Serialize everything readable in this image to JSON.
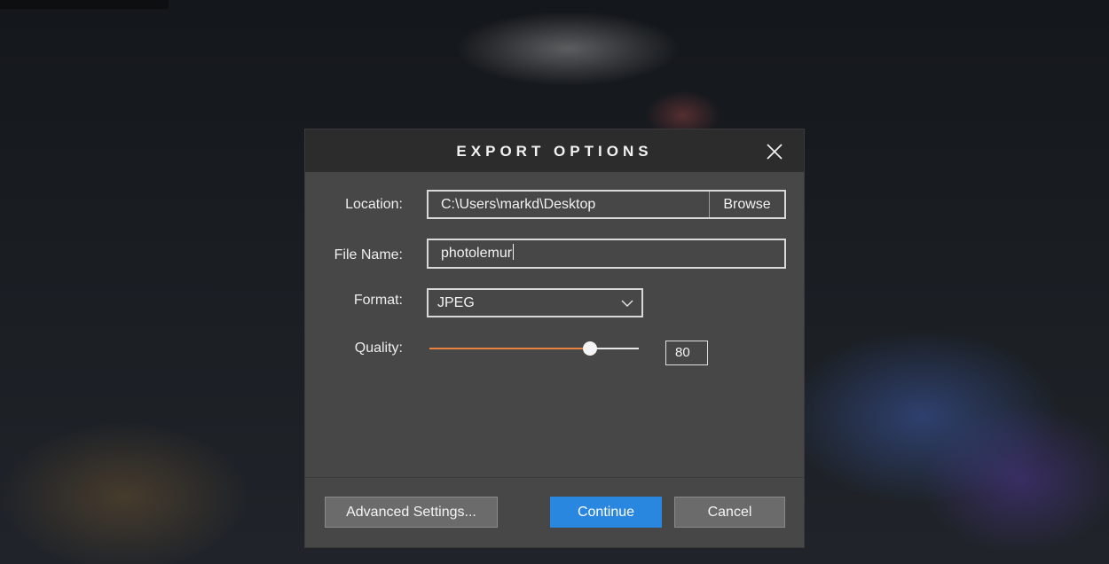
{
  "dialog": {
    "title": "EXPORT OPTIONS",
    "close_icon": "close-icon"
  },
  "location": {
    "label": "Location:",
    "value": "C:\\Users\\markd\\Desktop",
    "browse_label": "Browse"
  },
  "file_name": {
    "label": "File Name:",
    "value": "photolemur"
  },
  "format": {
    "label": "Format:",
    "selected": "JPEG",
    "dropdown_icon": "chevron-down-icon"
  },
  "quality": {
    "label": "Quality:",
    "value": "80",
    "percent": 80
  },
  "footer": {
    "advanced_label": "Advanced Settings...",
    "continue_label": "Continue",
    "cancel_label": "Cancel"
  },
  "colors": {
    "accent_orange": "#e9813f",
    "primary_blue": "#2a87e0",
    "dialog_bg": "#474747",
    "titlebar_bg": "#2c2c2c"
  }
}
